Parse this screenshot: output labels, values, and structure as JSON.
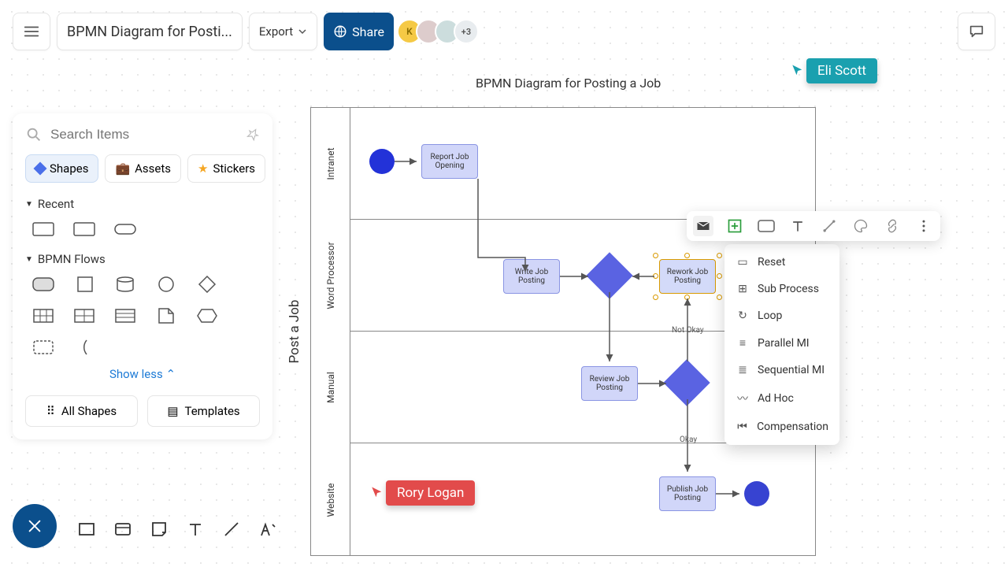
{
  "header": {
    "title": "BPMN Diagram for Posti...",
    "export": "Export",
    "share": "Share",
    "avatar_k": "K",
    "avatar_plus": "+3"
  },
  "sidebar": {
    "search_placeholder": "Search Items",
    "tabs": {
      "shapes": "Shapes",
      "assets": "Assets",
      "stickers": "Stickers"
    },
    "recent": "Recent",
    "bpmn": "BPMN Flows",
    "show_less": "Show less",
    "all_shapes": "All Shapes",
    "templates": "Templates"
  },
  "diagram": {
    "title": "BPMN Diagram for Posting a Job",
    "pool": "Post a Job",
    "lanes": [
      "Intranet",
      "Word Processor",
      "Manual",
      "Website"
    ],
    "tasks": {
      "report": "Report Job Opening",
      "write": "Write Job Posting",
      "rework": "Rework Job Posting",
      "review": "Review Job Posting",
      "publish": "Publish Job Posting"
    },
    "labels": {
      "not_okay": "Not Okay",
      "okay": "Okay"
    }
  },
  "cursors": {
    "eli": "Eli Scott",
    "rory": "Rory Logan"
  },
  "ctx_menu": [
    "Reset",
    "Sub Process",
    "Loop",
    "Parallel MI",
    "Sequential MI",
    "Ad Hoc",
    "Compensation"
  ]
}
